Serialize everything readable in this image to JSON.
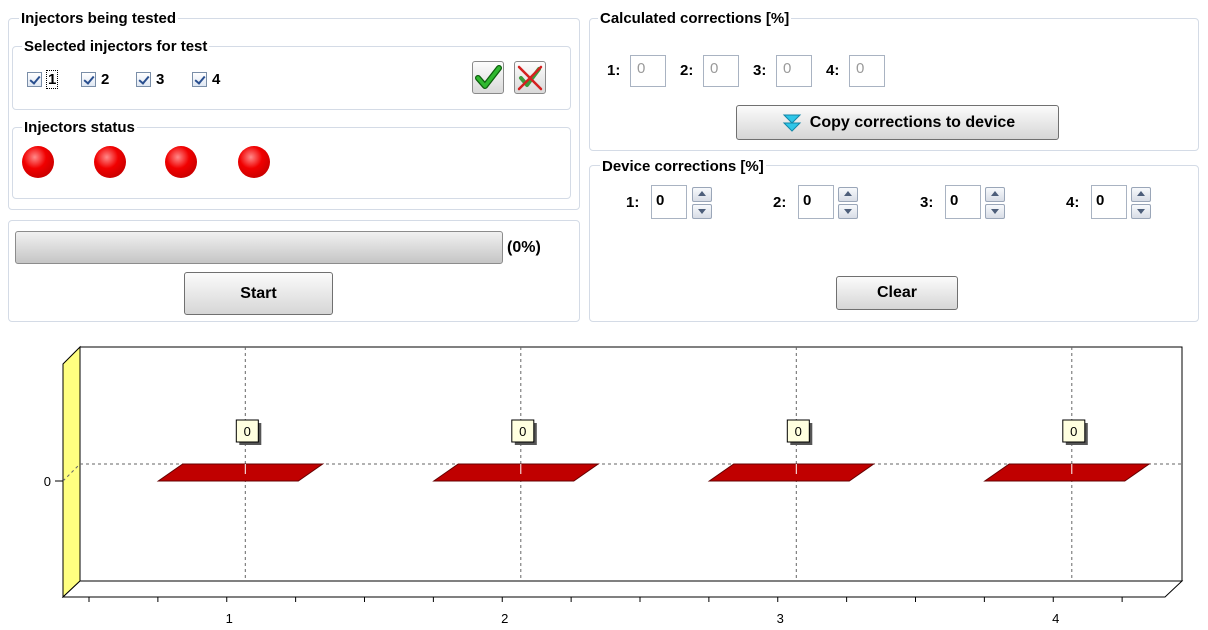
{
  "injectors_tested": {
    "title": "Injectors being tested",
    "selected": {
      "title": "Selected injectors for test",
      "items": [
        {
          "label": "1",
          "checked": true
        },
        {
          "label": "2",
          "checked": true
        },
        {
          "label": "3",
          "checked": true
        },
        {
          "label": "4",
          "checked": true
        }
      ],
      "select_all_icon": "green-check-icon",
      "deselect_all_icon": "clear-selection-icon"
    },
    "status": {
      "title": "Injectors status",
      "leds": [
        {
          "state": "off",
          "color": "#e00000"
        },
        {
          "state": "off",
          "color": "#e00000"
        },
        {
          "state": "off",
          "color": "#e00000"
        },
        {
          "state": "off",
          "color": "#e00000"
        }
      ]
    }
  },
  "progress": {
    "percent": 0,
    "label": "(0%)",
    "start_label": "Start"
  },
  "calculated": {
    "title": "Calculated corrections [%]",
    "fields": [
      {
        "label": "1:",
        "value": "0"
      },
      {
        "label": "2:",
        "value": "0"
      },
      {
        "label": "3:",
        "value": "0"
      },
      {
        "label": "4:",
        "value": "0"
      }
    ],
    "copy_label": "Copy corrections to device"
  },
  "device": {
    "title": "Device corrections [%]",
    "fields": [
      {
        "label": "1:",
        "value": "0"
      },
      {
        "label": "2:",
        "value": "0"
      },
      {
        "label": "3:",
        "value": "0"
      },
      {
        "label": "4:",
        "value": "0"
      }
    ],
    "clear_label": "Clear"
  },
  "chart_data": {
    "type": "bar",
    "categories": [
      "1",
      "2",
      "3",
      "4"
    ],
    "values": [
      0,
      0,
      0,
      0
    ],
    "data_labels": [
      "0",
      "0",
      "0",
      "0"
    ],
    "y_ticks": [
      "0"
    ],
    "bar_color": "#c00000",
    "wall_color": "#ffff80",
    "grid": true,
    "title": "",
    "xlabel": "",
    "ylabel": ""
  }
}
